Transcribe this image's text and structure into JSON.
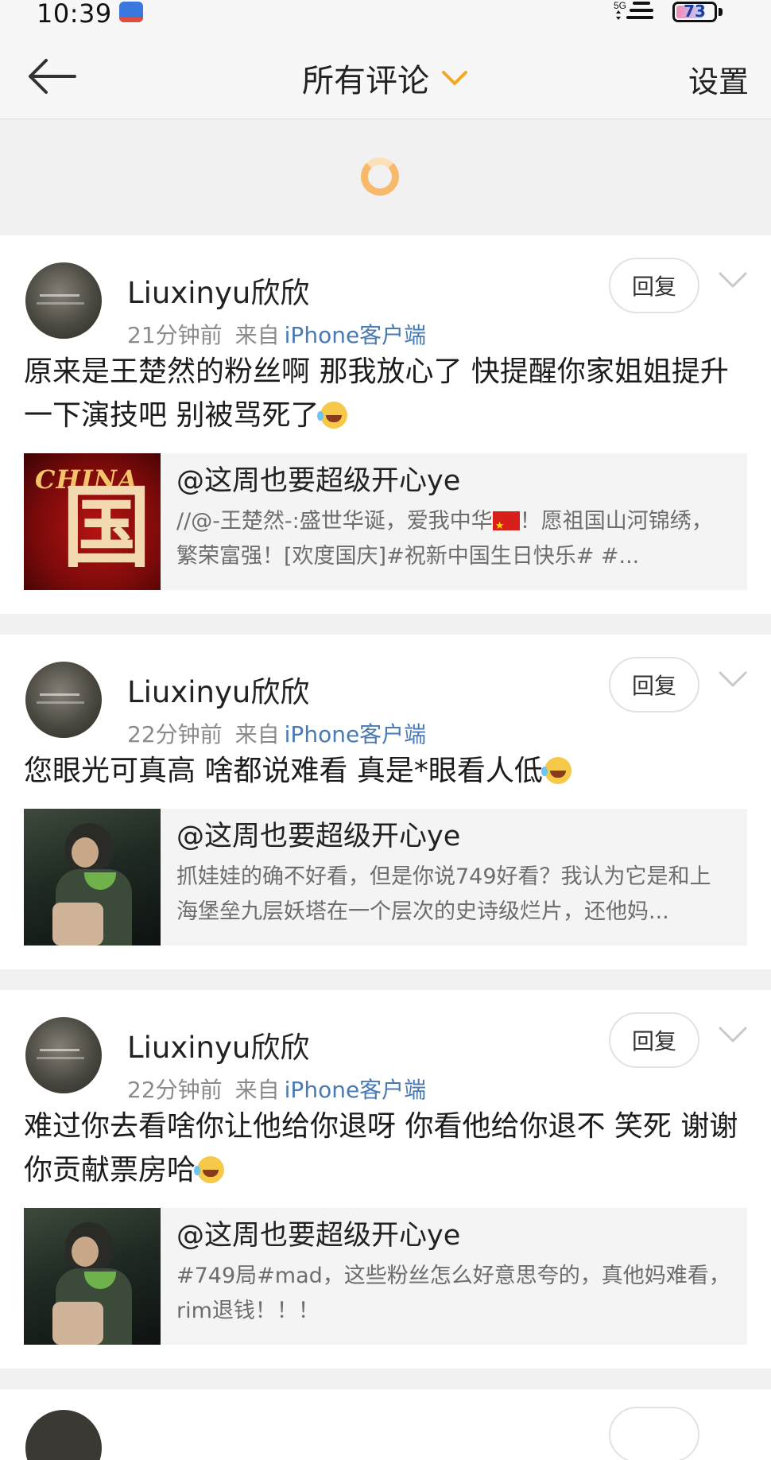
{
  "status_bar": {
    "time": "10:39",
    "network": "5G",
    "battery": "73",
    "battery_level_percent": 73
  },
  "navbar": {
    "title": "所有评论",
    "settings_label": "设置"
  },
  "comments": [
    {
      "username": "Liuxinyu欣欣",
      "time": "21分钟前",
      "from_label": "来自",
      "source": "iPhone客户端",
      "text": "原来是王楚然的粉丝啊 那我放心了 快提醒你家姐姐提升一下演技吧 别被骂死了",
      "reply_label": "回复",
      "quote": {
        "user": "@这周也要超级开心ye",
        "text_before_flag": "//@-王楚然-:盛世华诞，爱我中华",
        "text_after_flag": "！愿祖国山河锦绣，繁荣富强！[欢度国庆]#祝新中国生日快乐# #...",
        "thumb_text": "CHINA",
        "thumb_char": "国"
      }
    },
    {
      "username": "Liuxinyu欣欣",
      "time": "22分钟前",
      "from_label": "来自",
      "source": "iPhone客户端",
      "text": "您眼光可真高 啥都说难看 真是*眼看人低",
      "reply_label": "回复",
      "quote": {
        "user": "@这周也要超级开心ye",
        "text": "抓娃娃的确不好看，但是你说749好看？我认为它是和上海堡垒九层妖塔在一个层次的史诗级烂片，还他妈..."
      }
    },
    {
      "username": "Liuxinyu欣欣",
      "time": "22分钟前",
      "from_label": "来自",
      "source": "iPhone客户端",
      "text": "难过你去看啥你让他给你退呀 你看他给你退不 笑死 谢谢你贡献票房哈",
      "reply_label": "回复",
      "quote": {
        "user": "@这周也要超级开心ye",
        "text": "#749局#mad，这些粉丝怎么好意思夸的，真他妈难看，rim退钱！！！"
      }
    }
  ],
  "icons": {
    "back": "back-arrow-icon",
    "title_dropdown": "chevron-down-icon",
    "loading": "loading-spinner-icon",
    "more": "chevron-down-icon",
    "emoji": "laugh-cry-emoji-icon"
  },
  "colors": {
    "accent": "#f5a623",
    "link": "#4a7ab3",
    "meta": "#8b8b8b",
    "background": "#f1f1f1"
  }
}
